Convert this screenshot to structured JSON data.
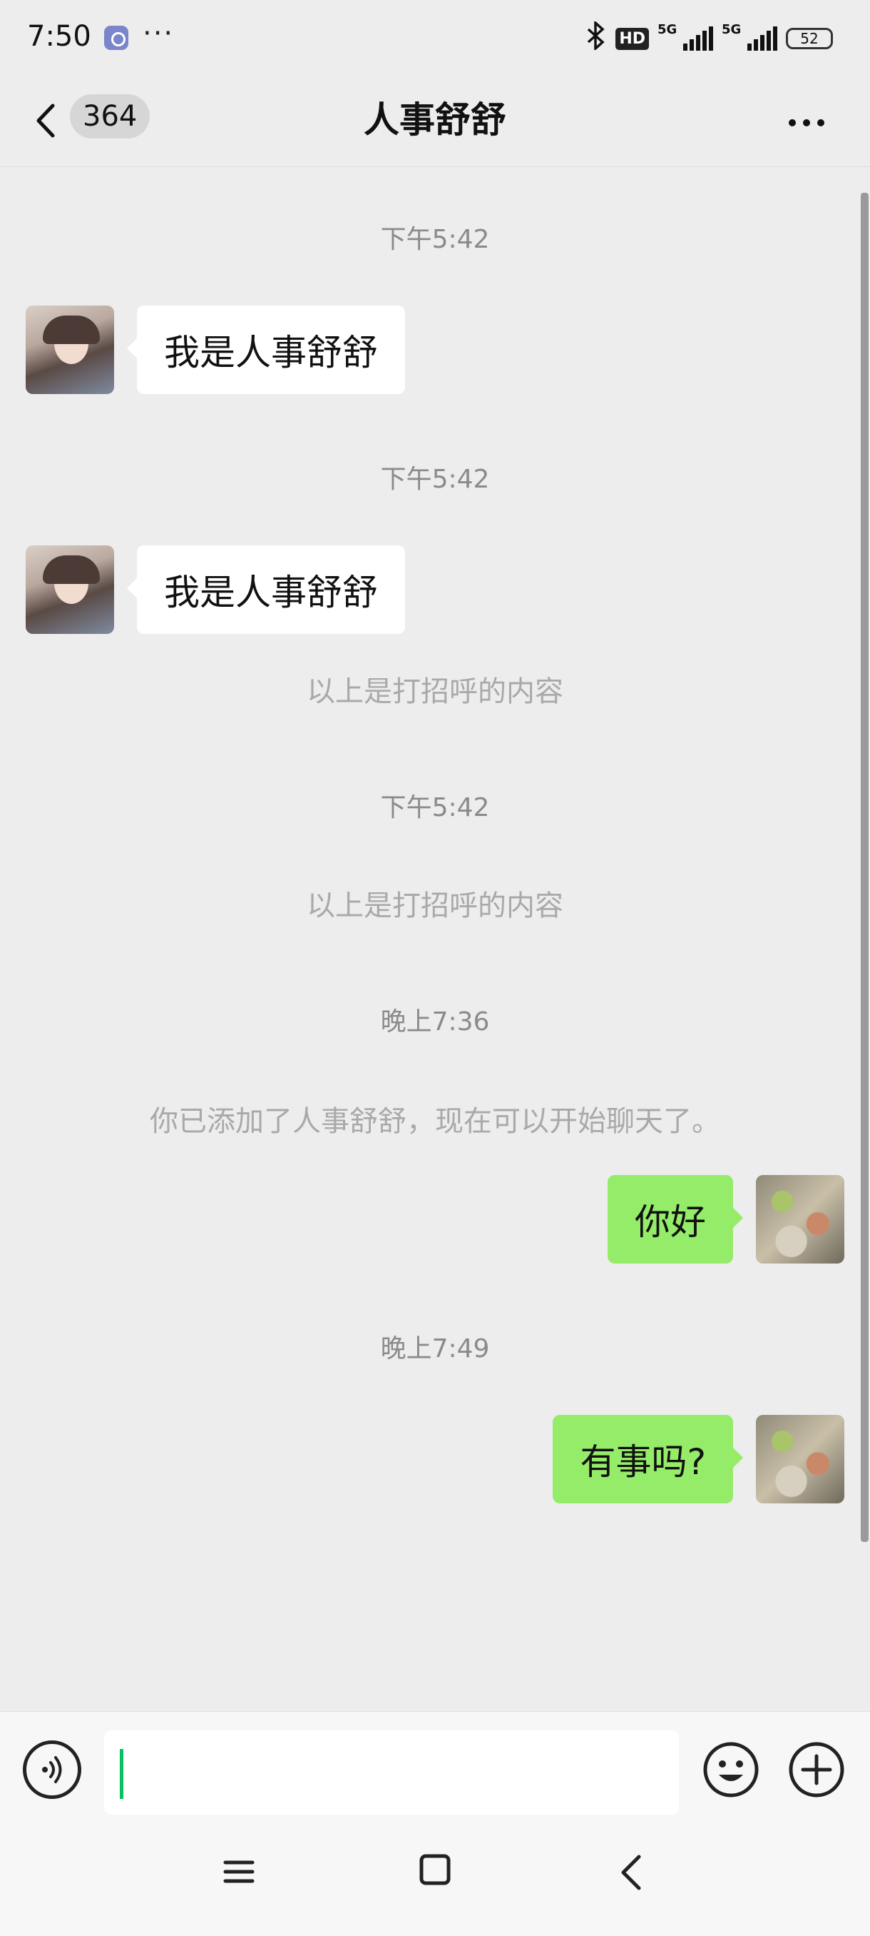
{
  "status_bar": {
    "time": "7:50",
    "more": "···",
    "hd_badge": "HD",
    "sig1_label": "5G",
    "sig2_label": "5G",
    "battery": "52",
    "bluetooth_icon": "bluetooth-icon"
  },
  "header": {
    "unread_count": "364",
    "title": "人事舒舒"
  },
  "messages": {
    "ts1": "下午5:42",
    "m1": "我是人事舒舒",
    "ts2": "下午5:42",
    "m2": "我是人事舒舒",
    "sys1": "以上是打招呼的内容",
    "ts3": "下午5:42",
    "sys2": "以上是打招呼的内容",
    "ts4": "晚上7:36",
    "sys3": "你已添加了人事舒舒，现在可以开始聊天了。",
    "m3": "你好",
    "ts5": "晚上7:49",
    "m4": "有事吗?"
  },
  "input": {
    "value": "",
    "placeholder": ""
  },
  "colors": {
    "accent": "#07c160",
    "outgoing_bubble": "#95ec69",
    "incoming_bubble": "#ffffff",
    "background": "#ededed"
  }
}
